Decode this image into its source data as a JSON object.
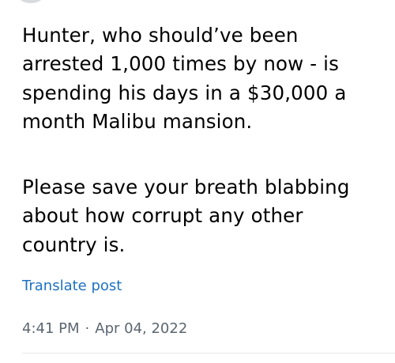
{
  "post": {
    "paragraphs": [
      {
        "lines": [
          "Hunter, who should’ve been",
          "arrested 1,000 times by now - is",
          "spending his days in a $30,000 a",
          "month Malibu mansion."
        ]
      },
      {
        "lines": [
          "Please save your breath blabbing",
          "about how corrupt any other",
          "country is."
        ]
      }
    ],
    "translate_label": "Translate post",
    "time": "4:41 PM",
    "separator": "·",
    "date": "Apr 04, 2022"
  }
}
